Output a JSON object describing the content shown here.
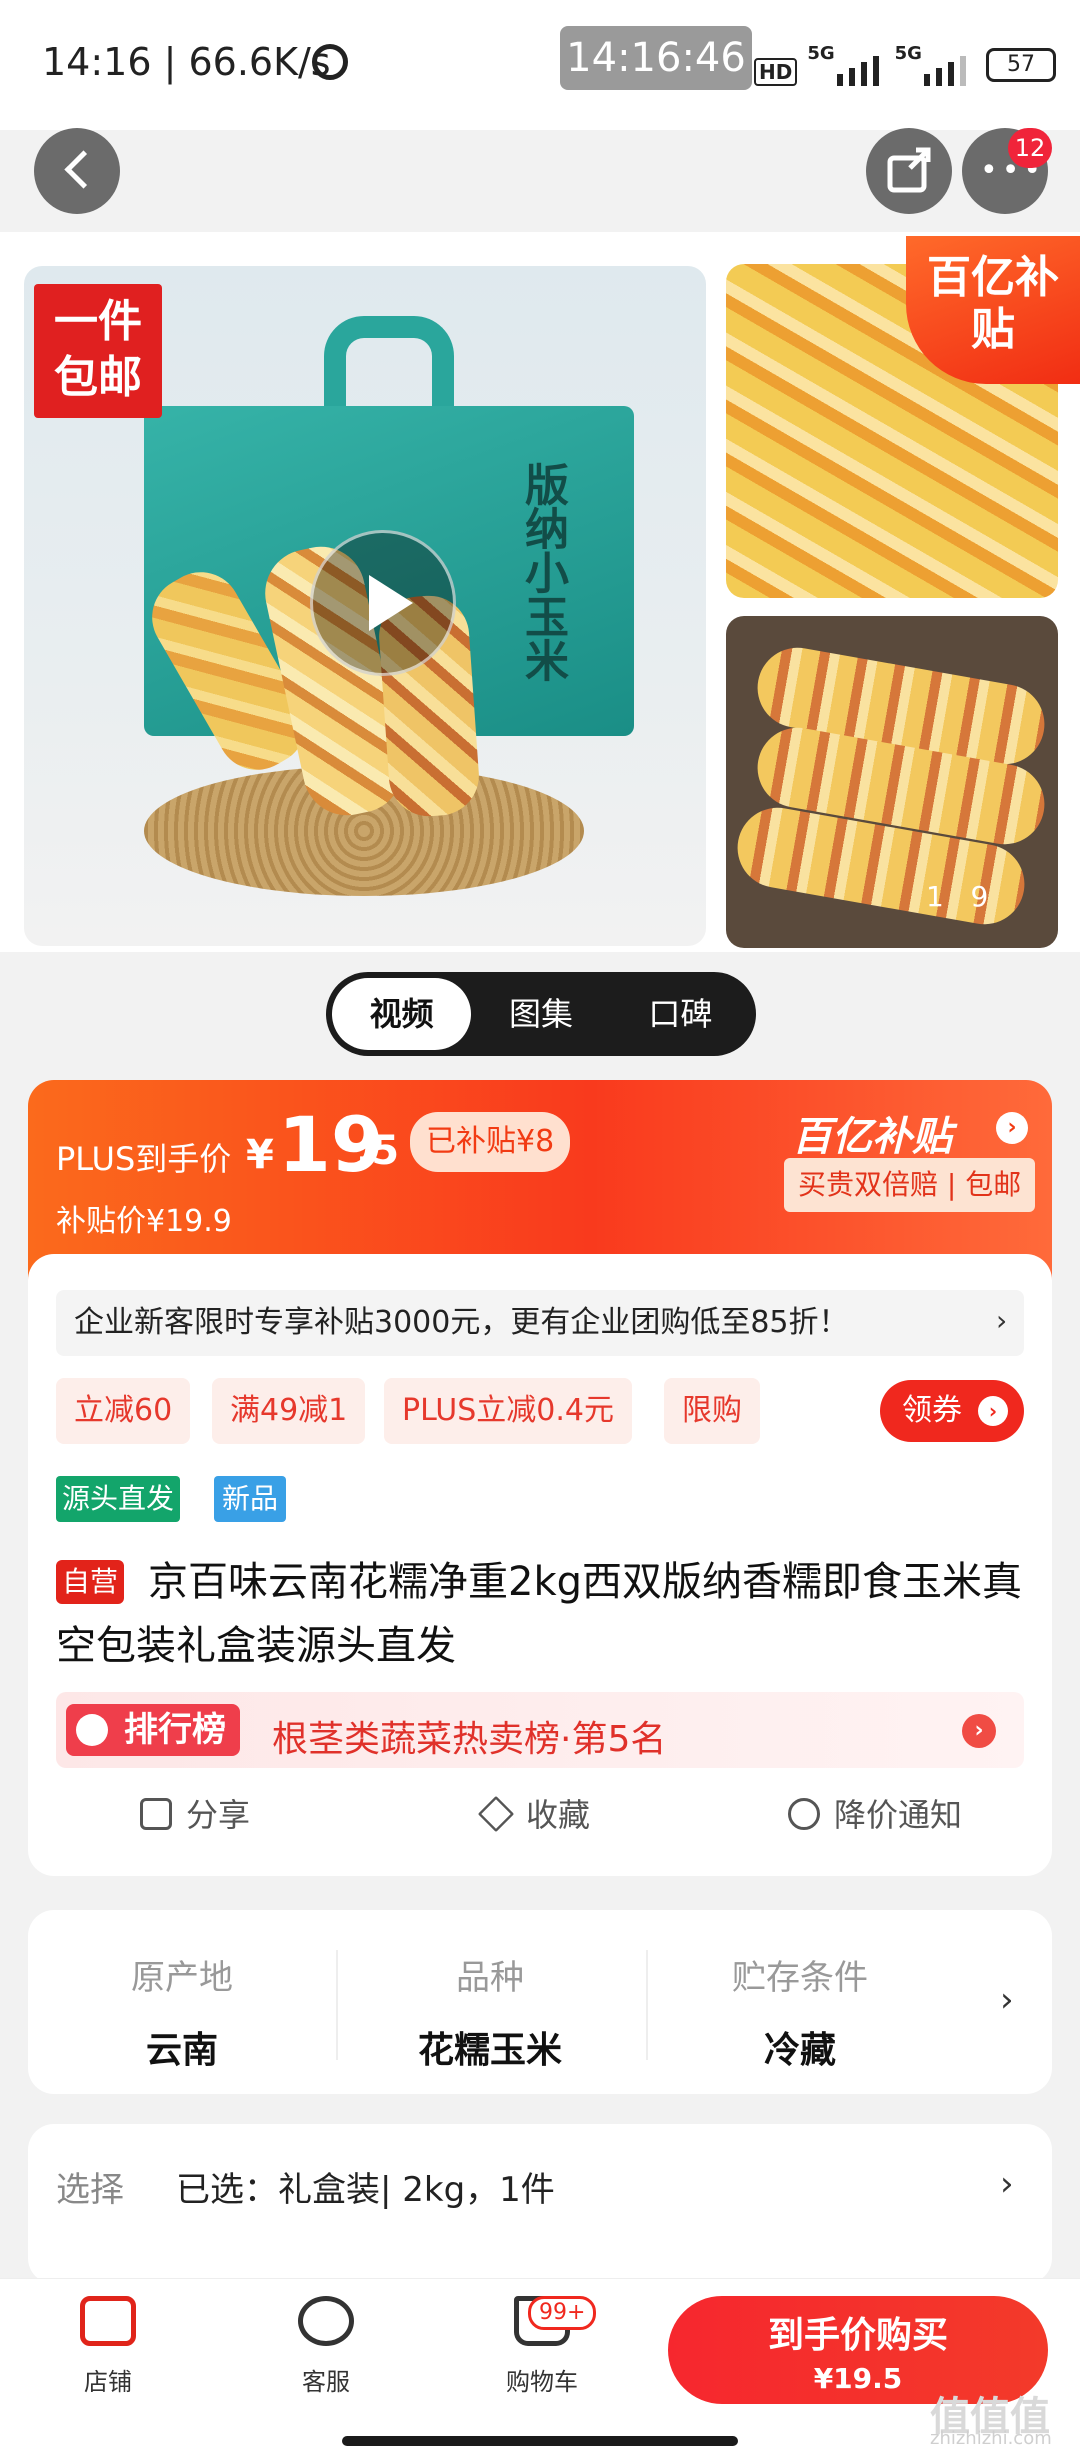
{
  "status_bar": {
    "time_speed": "14:16 | 66.6K/s",
    "overlay_clock": "14:16:46",
    "hd_tag": "HD",
    "network_1": "5G",
    "network_2": "5G",
    "battery": "57"
  },
  "top_nav": {
    "more_badge": "12"
  },
  "gallery": {
    "free_shipping_tag": "一件包邮",
    "box_title": "版纳小玉米",
    "subsidy_badge": "百亿补贴",
    "counter": "1   9"
  },
  "media_tabs": [
    {
      "label": "视频"
    },
    {
      "label": "图集"
    },
    {
      "label": "口碑"
    }
  ],
  "price": {
    "plus_label": "PLUS到手价",
    "currency": "¥",
    "integer": "19",
    "decimal": ".5",
    "subsidized_tag": "已补贴¥8",
    "sub_price": "补贴价¥19.9",
    "subsidy_logo": "百亿补贴",
    "guarantee": "买贵双倍赔 | 包邮"
  },
  "promo": {
    "enterprise_text": "企业新客限时专享补贴3000元，更有企业团购低至85折！",
    "coupons": [
      "立减60",
      "满49减1",
      "PLUS立减0.4元",
      "限购"
    ],
    "claim_button": "领券",
    "labels": [
      "源头直发",
      "新品"
    ]
  },
  "product": {
    "self_tag": "自营",
    "title": "京百味云南花糯净重2kg西双版纳香糯即食玉米真空包装礼盒装源头直发"
  },
  "ranking": {
    "badge": "排行榜",
    "text": "根茎类蔬菜热卖榜·第5名"
  },
  "actions": {
    "share": "分享",
    "favorite": "收藏",
    "price_alert": "降价通知"
  },
  "attributes": [
    {
      "label": "原产地",
      "value": "云南"
    },
    {
      "label": "品种",
      "value": "花糯玉米"
    },
    {
      "label": "贮存条件",
      "value": "冷藏"
    }
  ],
  "selection": {
    "label": "选择",
    "value": "已选：礼盒装| 2kg，1件"
  },
  "bottom_bar": {
    "store": "店铺",
    "service": "客服",
    "cart": "购物车",
    "cart_badge": "99+",
    "buy_main": "到手价购买",
    "buy_price": "¥19.5"
  },
  "watermark": {
    "text": "值值值",
    "url": "zhizhizhi.com"
  },
  "colors": {
    "brand_red": "#f0281e",
    "subsidy_orange": "#fb6a1c"
  }
}
